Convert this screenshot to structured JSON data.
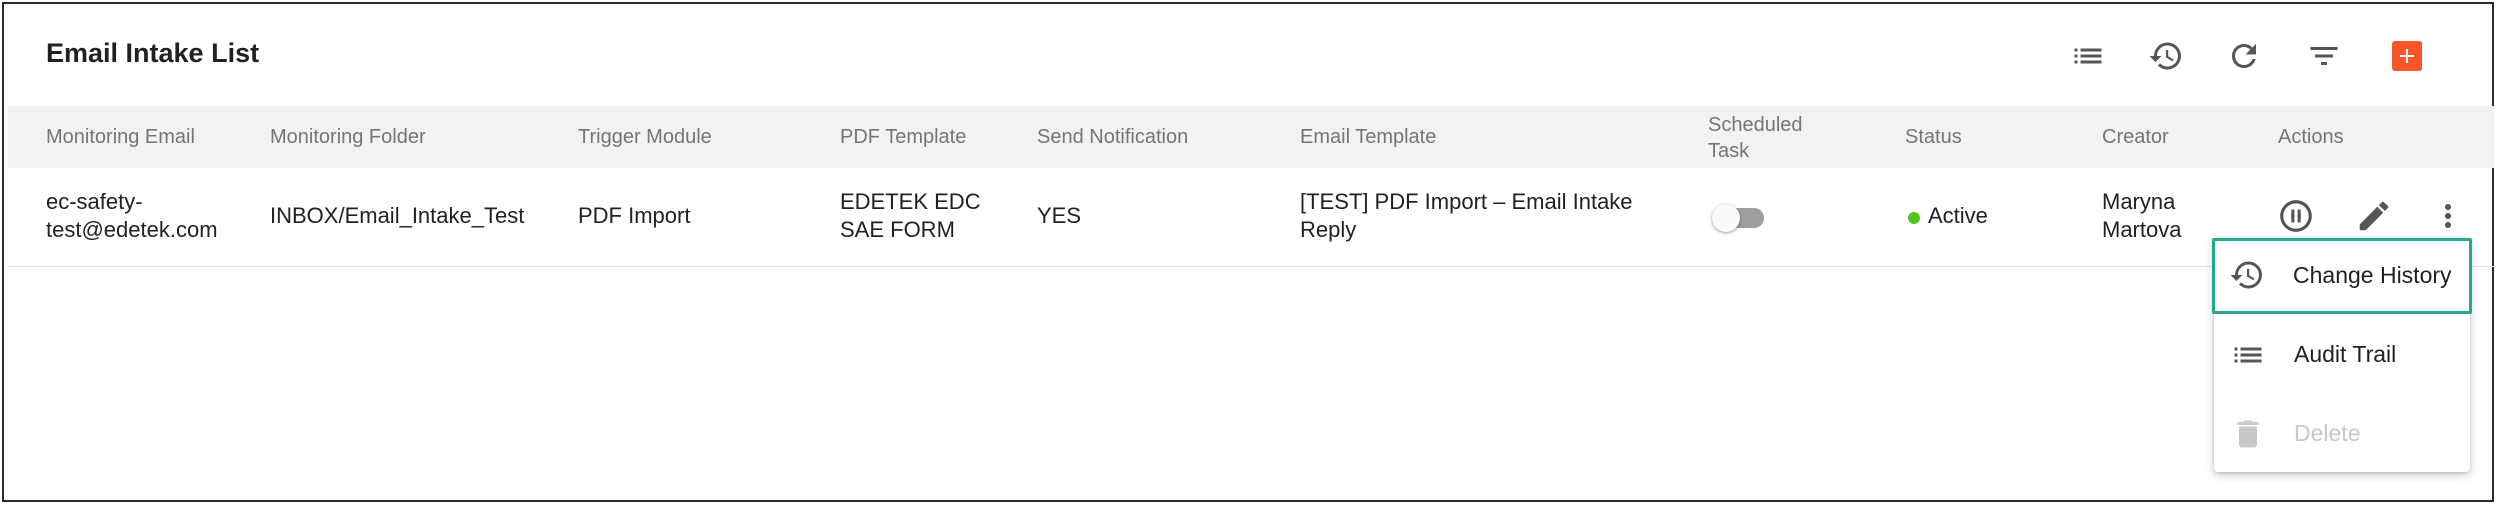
{
  "page": {
    "title": "Email Intake List"
  },
  "toolbar": {
    "icons": [
      "list-icon",
      "history-icon",
      "refresh-icon",
      "filter-icon",
      "add-icon"
    ],
    "add_color": "#f5572a"
  },
  "table": {
    "columns": [
      "Monitoring Email",
      "Monitoring Folder",
      "Trigger Module",
      "PDF Template",
      "Send Notification",
      "Email Template",
      "Scheduled Task",
      "Status",
      "Creator",
      "Actions"
    ],
    "rows": [
      {
        "monitoring_email": "ec-safety-test@edetek.com",
        "monitoring_folder": "INBOX/Email_Intake_Test",
        "trigger_module": "PDF Import",
        "pdf_template": "EDETEK EDC SAE FORM",
        "send_notification": "YES",
        "email_template": "[TEST] PDF Import – Email Intake Reply",
        "scheduled_task_enabled": false,
        "status": "Active",
        "status_color": "#52c41a",
        "creator": "Maryna Martova"
      }
    ]
  },
  "row_menu": {
    "items": [
      {
        "label": "Change History",
        "icon": "history-icon",
        "enabled": true,
        "highlighted": true
      },
      {
        "label": "Audit Trail",
        "icon": "list-icon",
        "enabled": true
      },
      {
        "label": "Delete",
        "icon": "trash-icon",
        "enabled": false
      }
    ],
    "highlight_color": "#26a88e"
  }
}
